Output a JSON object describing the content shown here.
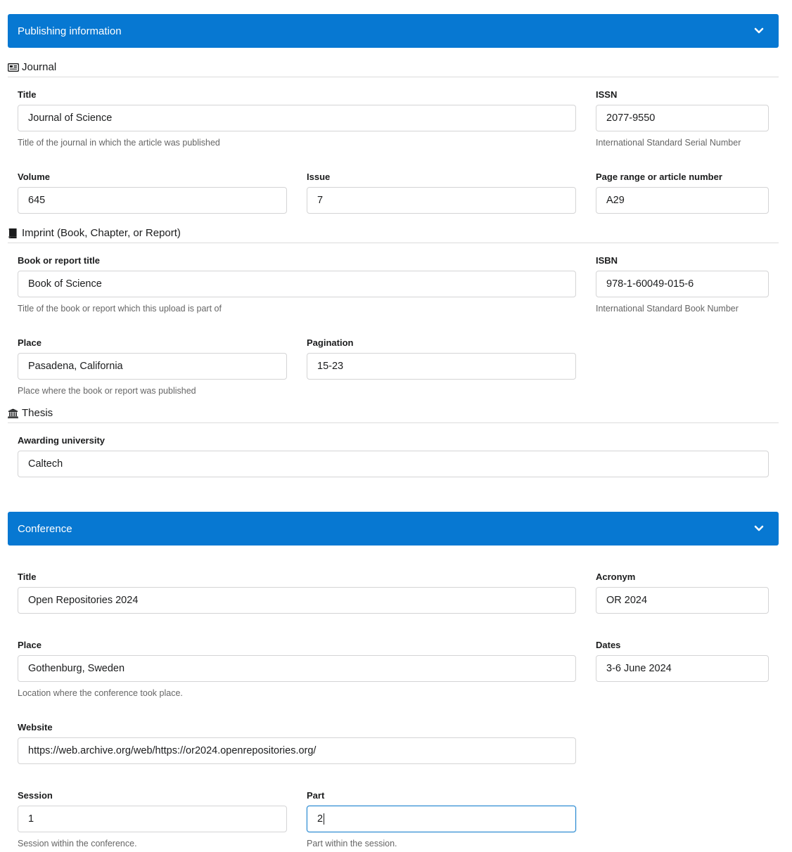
{
  "publishing": {
    "header": "Publishing information",
    "journal": {
      "section_title": "Journal",
      "title_label": "Title",
      "title_value": "Journal of Science",
      "title_help": "Title of the journal in which the article was published",
      "issn_label": "ISSN",
      "issn_value": "2077-9550",
      "issn_help": "International Standard Serial Number",
      "volume_label": "Volume",
      "volume_value": "645",
      "issue_label": "Issue",
      "issue_value": "7",
      "pages_label": "Page range or article number",
      "pages_value": "A29"
    },
    "imprint": {
      "section_title": "Imprint (Book, Chapter, or Report)",
      "book_title_label": "Book or report title",
      "book_title_value": "Book of Science",
      "book_title_help": "Title of the book or report which this upload is part of",
      "isbn_label": "ISBN",
      "isbn_value": "978-1-60049-015-6",
      "isbn_help": "International Standard Book Number",
      "place_label": "Place",
      "place_value": "Pasadena, California",
      "place_help": "Place where the book or report was published",
      "pagination_label": "Pagination",
      "pagination_value": "15-23"
    },
    "thesis": {
      "section_title": "Thesis",
      "university_label": "Awarding university",
      "university_value": "Caltech"
    }
  },
  "conference": {
    "header": "Conference",
    "title_label": "Title",
    "title_value": "Open Repositories 2024",
    "acronym_label": "Acronym",
    "acronym_value": "OR 2024",
    "place_label": "Place",
    "place_value": "Gothenburg, Sweden",
    "place_help": "Location where the conference took place.",
    "dates_label": "Dates",
    "dates_value": "3-6 June 2024",
    "website_label": "Website",
    "website_value": "https://web.archive.org/web/https://or2024.openrepositories.org/",
    "session_label": "Session",
    "session_value": "1",
    "session_help": "Session within the conference.",
    "part_label": "Part",
    "part_value": "2",
    "part_help": "Part within the session."
  },
  "colors": {
    "header_bg": "#0778d2",
    "focus_border": "#2185d0"
  },
  "icons": {
    "accordion": "chevron-down-icon",
    "journal": "newspaper-icon",
    "imprint": "book-icon",
    "thesis": "university-icon"
  }
}
